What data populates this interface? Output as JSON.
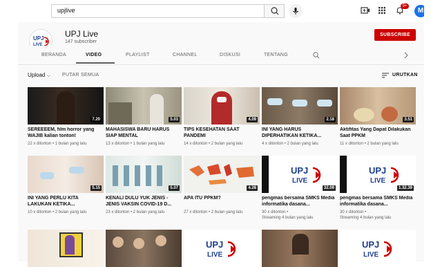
{
  "topbar": {
    "search_value": "upjlive",
    "avatar_letter": "M",
    "notifications": "9+"
  },
  "channel": {
    "name": "UPJ Live",
    "subscribers": "147 subscriber",
    "subscribe_label": "SUBSCRIBE"
  },
  "tabs": [
    "BERANDA",
    "VIDEO",
    "PLAYLIST",
    "CHANNEL",
    "DISKUSI",
    "TENTANG"
  ],
  "filters": {
    "upload_label": "Upload",
    "play_all": "PUTAR SEMUA",
    "sort": "URUTKAN"
  },
  "videos": [
    {
      "title": "SEREEEEM, film horror yang WAJIB kalian tonton!",
      "meta": "22 x ditonton • 1 bulan yang lalu",
      "duration": "7.20"
    },
    {
      "title": "MAHASISWA BARU HARUS SIAP MENTAL",
      "meta": "13 x ditonton • 1 bulan yang lalu",
      "duration": "5.03"
    },
    {
      "title": "TIPS KESEHATAN SAAT PANDEMI",
      "meta": "14 x ditonton • 2 bulan yang lalu",
      "duration": "4.09"
    },
    {
      "title": "INI YANG HARUS DIPERHATIKAN KETIKA...",
      "meta": "4 x ditonton • 2 bulan yang lalu",
      "duration": "2.18"
    },
    {
      "title": "Aktifitas Yang Dapat Dilakukan Saat PPKM",
      "meta": "11 x ditonton • 2 bulan yang lalu",
      "duration": "3.51"
    },
    {
      "title": "INI YANG PERLU KITA LAKUKAN KETIKA...",
      "meta": "10 x ditonton • 2 bulan yang lalu",
      "duration": "5.15"
    },
    {
      "title": "KENALI DULU YUK JENIS - JENIS VAKSIN COVID-19 D...",
      "meta": "23 x ditonton • 2 bulan yang lalu",
      "duration": "5.07"
    },
    {
      "title": "APA ITU PPKM?",
      "meta": "27 x ditonton • 2 bulan yang lalu",
      "duration": "4.28"
    },
    {
      "title": "pengmas bersama SMKS Media informatika dasana...",
      "meta": "30 x ditonton •",
      "meta2": "Streaming 4 bulan yang lalu",
      "duration": "32.09"
    },
    {
      "title": "pengmas bersama SMKS Media informatika dasana...",
      "meta": "30 x ditonton •",
      "meta2": "Streaming 4 bulan yang lalu",
      "duration": "1.32.39"
    }
  ],
  "logo_text": {
    "top": "UPJ",
    "bottom": "LIVE"
  },
  "colors": {
    "accent": "#cc0000",
    "logo_blue": "#1d3f8f"
  }
}
